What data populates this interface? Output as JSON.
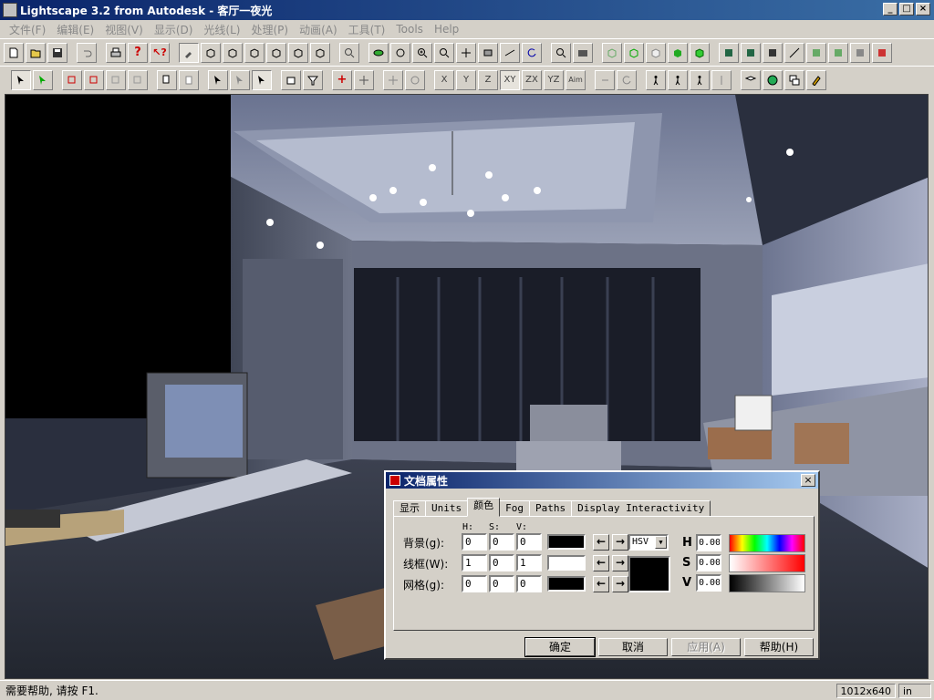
{
  "window": {
    "title": "Lightscape 3.2 from Autodesk - 客厅一夜光",
    "min": "_",
    "max": "□",
    "close": "×"
  },
  "menu": [
    "文件(F)",
    "编辑(E)",
    "视图(V)",
    "显示(D)",
    "光线(L)",
    "处理(P)",
    "动画(A)",
    "工具(T)",
    "Tools",
    "Help"
  ],
  "toolbar2_labels": {
    "x": "X",
    "y": "Y",
    "z": "Z",
    "xy": "XY",
    "zx": "ZX",
    "yz": "YZ",
    "aim": "Aim"
  },
  "dialog": {
    "title": "文档属性",
    "close": "×",
    "tabs": [
      "显示",
      "Units",
      "颜色",
      "Fog",
      "Paths",
      "Display Interactivity"
    ],
    "active_tab": "颜色",
    "headers": {
      "h": "H:",
      "s": "S:",
      "v": "V:"
    },
    "rows": [
      {
        "label": "背景(g):",
        "h": "0",
        "s": "0",
        "v": "0",
        "color": "#000000"
      },
      {
        "label": "线框(W):",
        "h": "1",
        "s": "0",
        "v": "1",
        "color": "#ffffff"
      },
      {
        "label": "网格(g):",
        "h": "0",
        "s": "0",
        "v": "0",
        "color": "#000000"
      }
    ],
    "mode": "HSV",
    "mode_arrow": "▼",
    "hsv_labels": {
      "h": "H",
      "s": "S",
      "v": "V"
    },
    "hsv_values": {
      "h": "0.00",
      "s": "0.00",
      "v": "0.00"
    },
    "arrows": {
      "left": "←",
      "right": "→"
    },
    "buttons": {
      "ok": "确定",
      "cancel": "取消",
      "apply": "应用(A)",
      "help": "帮助(H)"
    }
  },
  "status": {
    "message": "需要帮助, 请按 F1.",
    "resolution": "1012x640",
    "unit": "in"
  }
}
